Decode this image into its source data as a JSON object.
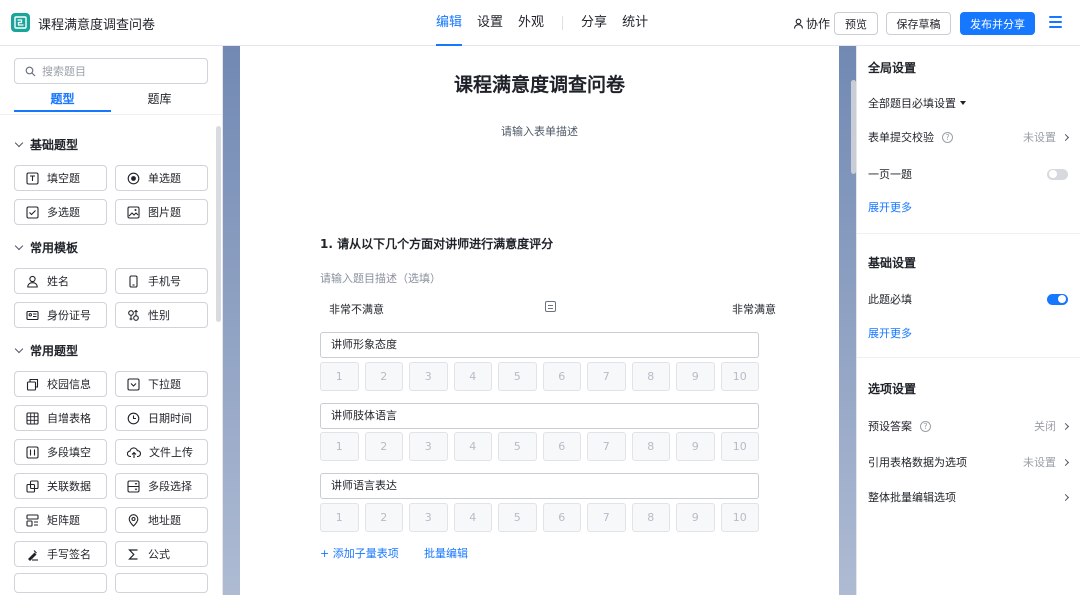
{
  "app": {
    "title": "课程满意度调查问卷"
  },
  "nav": {
    "tabs": [
      {
        "label": "编辑"
      },
      {
        "label": "设置"
      },
      {
        "label": "外观"
      },
      {
        "label": "分享"
      },
      {
        "label": "统计"
      }
    ],
    "active_tab": "编辑"
  },
  "toolbar": {
    "collab_label": "协作",
    "preview_label": "预览",
    "save_draft_label": "保存草稿",
    "publish_label": "发布并分享"
  },
  "left_panel": {
    "search_placeholder": "搜索题目",
    "tabs": [
      {
        "label": "题型"
      },
      {
        "label": "题库"
      }
    ],
    "sections": [
      {
        "title": "基础题型",
        "items": [
          {
            "label": "填空题",
            "icon": "text-field-icon"
          },
          {
            "label": "单选题",
            "icon": "radio-icon"
          },
          {
            "label": "多选题",
            "icon": "checkbox-icon"
          },
          {
            "label": "图片题",
            "icon": "image-icon"
          }
        ]
      },
      {
        "title": "常用模板",
        "items": [
          {
            "label": "姓名",
            "icon": "user-icon"
          },
          {
            "label": "手机号",
            "icon": "phone-icon"
          },
          {
            "label": "身份证号",
            "icon": "id-card-icon"
          },
          {
            "label": "性别",
            "icon": "gender-icon"
          }
        ]
      },
      {
        "title": "常用题型",
        "items": [
          {
            "label": "校园信息",
            "icon": "campus-icon"
          },
          {
            "label": "下拉题",
            "icon": "dropdown-icon"
          },
          {
            "label": "自增表格",
            "icon": "table-icon"
          },
          {
            "label": "日期时间",
            "icon": "clock-icon"
          },
          {
            "label": "多段填空",
            "icon": "multi-fill-icon"
          },
          {
            "label": "文件上传",
            "icon": "upload-icon"
          },
          {
            "label": "关联数据",
            "icon": "link-data-icon"
          },
          {
            "label": "多段选择",
            "icon": "multi-select-icon"
          },
          {
            "label": "矩阵题",
            "icon": "matrix-icon"
          },
          {
            "label": "地址题",
            "icon": "location-icon"
          },
          {
            "label": "手写签名",
            "icon": "signature-icon"
          },
          {
            "label": "公式",
            "icon": "sigma-icon"
          }
        ]
      }
    ]
  },
  "form": {
    "title": "课程满意度调查问卷",
    "description_placeholder": "请输入表单描述",
    "question": {
      "title": "1. 请从以下几个方面对讲师进行满意度评分",
      "description_placeholder": "请输入题目描述（选填）",
      "scale_left_label": "非常不满意",
      "scale_right_label": "非常满意",
      "scale": [
        "1",
        "2",
        "3",
        "4",
        "5",
        "6",
        "7",
        "8",
        "9",
        "10"
      ],
      "sub_items": [
        {
          "label": "讲师形象态度"
        },
        {
          "label": "讲师肢体语言"
        },
        {
          "label": "讲师语言表达"
        }
      ],
      "add_sub_link": "+ 添加子量表项",
      "batch_edit_link": "批量编辑"
    }
  },
  "right_panel": {
    "global": {
      "title": "全局设置",
      "required_all_label": "全部题目必填设置",
      "validation_label": "表单提交校验",
      "validation_value": "未设置",
      "one_per_page_label": "一页一题",
      "one_per_page_on": false,
      "expand_label": "展开更多"
    },
    "basic": {
      "title": "基础设置",
      "required_label": "此题必填",
      "required_on": true,
      "expand_label": "展开更多"
    },
    "options": {
      "title": "选项设置",
      "preset_label": "预设答案",
      "preset_value": "关闭",
      "table_ref_label": "引用表格数据为选项",
      "table_ref_value": "未设置",
      "batch_label": "整体批量编辑选项"
    }
  },
  "colors": {
    "accent": "#1677ff",
    "logo": "#1aa59a",
    "canvas_bg": "#6f86b0"
  }
}
